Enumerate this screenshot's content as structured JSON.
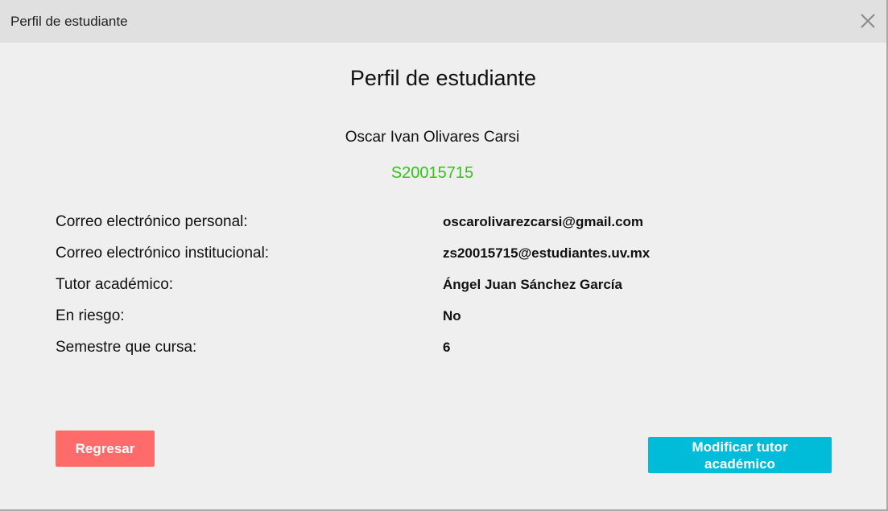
{
  "window": {
    "title": "Perfil de estudiante",
    "close_icon": "close-icon"
  },
  "profile": {
    "heading": "Perfil de estudiante",
    "name": "Oscar Ivan Olivares Carsi",
    "student_id": "S20015715",
    "student_id_color": "#33c41a"
  },
  "fields": [
    {
      "label": "Correo electrónico personal:",
      "value": "oscarolivarezcarsi@gmail.com"
    },
    {
      "label": "Correo electrónico institucional:",
      "value": "zs20015715@estudiantes.uv.mx"
    },
    {
      "label": "Tutor académico:",
      "value": "Ángel Juan Sánchez García"
    },
    {
      "label": "En riesgo:",
      "value": "No"
    },
    {
      "label": "Semestre que cursa:",
      "value": "6"
    }
  ],
  "buttons": {
    "back_label": "Regresar",
    "back_color": "#ff6b6b",
    "modify_label": "Modificar tutor académico",
    "modify_color": "#00bcd8"
  }
}
